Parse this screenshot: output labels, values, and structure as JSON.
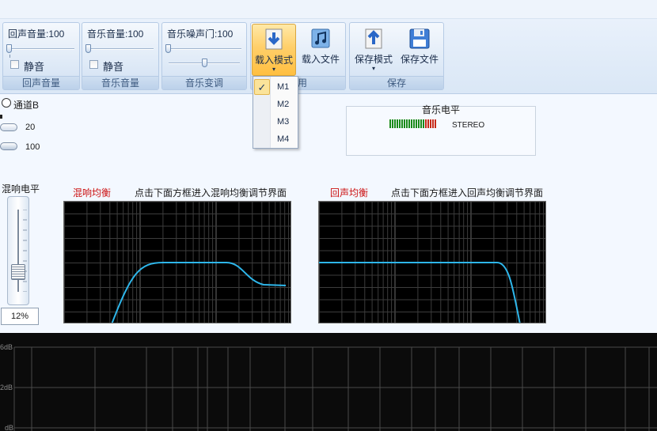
{
  "ribbon": {
    "echo_group": {
      "title": "回声音量:100",
      "mute_label": "静音",
      "group_label": "回声音量"
    },
    "music_group": {
      "title": "音乐音量:100",
      "mute_label": "静音",
      "group_label": "音乐音量"
    },
    "noise_group": {
      "title": "音乐噪声门:100",
      "group_label": "音乐变调"
    },
    "load_group": {
      "load_mode": "载入模式",
      "load_file": "载入文件",
      "group_label_partial": "用"
    },
    "save_group": {
      "save_mode": "保存模式",
      "save_file": "保存文件",
      "group_label": "保存"
    }
  },
  "dropdown": {
    "items": [
      "M1",
      "M2",
      "M3",
      "M4"
    ],
    "selected": "M1",
    "check": "✓"
  },
  "left_controls": {
    "channel_b": "通道B",
    "slider1_value": "20",
    "slider2_value": "100",
    "mix_level_label": "混响电平",
    "mix_level_percent": "12%"
  },
  "music_level": {
    "title": "音乐电平",
    "mode": "STEREO"
  },
  "reverb_eq": {
    "label": "混响均衡",
    "hint": "点击下面方框进入混响均衡调节界面"
  },
  "echo_eq": {
    "label": "回声均衡",
    "hint": "点击下面方框进入回声均衡调节界面"
  },
  "spectrum": {
    "axis_labels": [
      "6dB",
      "2dB",
      "dB"
    ]
  },
  "colors": {
    "eq_curve": "#2eb6ea",
    "eq_label_red": "#cc1111",
    "vu_green": "#1a8a1a",
    "vu_red": "#c82a18"
  }
}
